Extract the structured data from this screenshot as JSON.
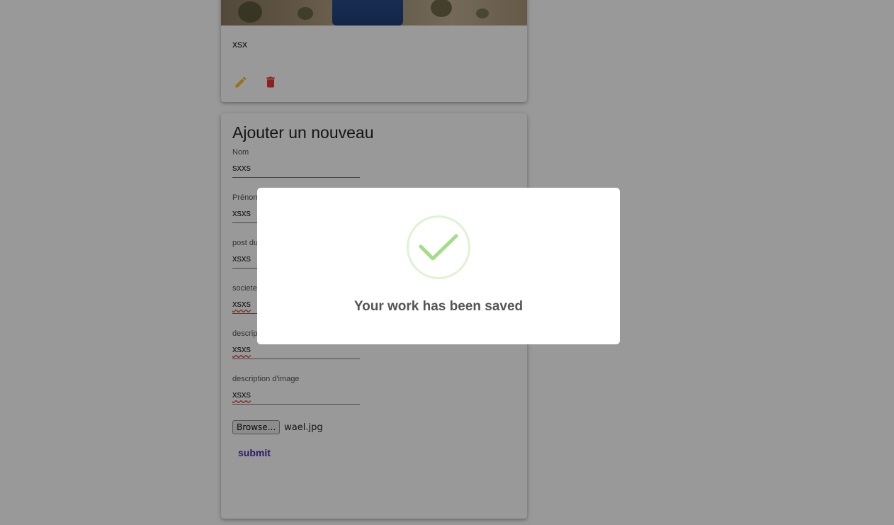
{
  "card": {
    "caption": "xsx",
    "edit_icon": "pencil-icon",
    "delete_icon": "trash-icon",
    "edit_color": "#f2c230",
    "delete_color": "#e53935"
  },
  "form": {
    "title": "Ajouter un nouveau",
    "fields": [
      {
        "label": "Nom",
        "value": "sxxs"
      },
      {
        "label": "Prénom",
        "value": "xsxs"
      },
      {
        "label": "post du",
        "value": "xsxs"
      },
      {
        "label": "societe",
        "value": "xsxs"
      },
      {
        "label": "description",
        "value": "xsxs"
      },
      {
        "label": "description d'image",
        "value": "xsxs"
      }
    ],
    "file_button": "Browse...",
    "file_name": "wael.jpg",
    "submit": "submit"
  },
  "dialog": {
    "icon": "check-icon",
    "message": "Your work has been saved",
    "success_color": "#a5dc86"
  }
}
